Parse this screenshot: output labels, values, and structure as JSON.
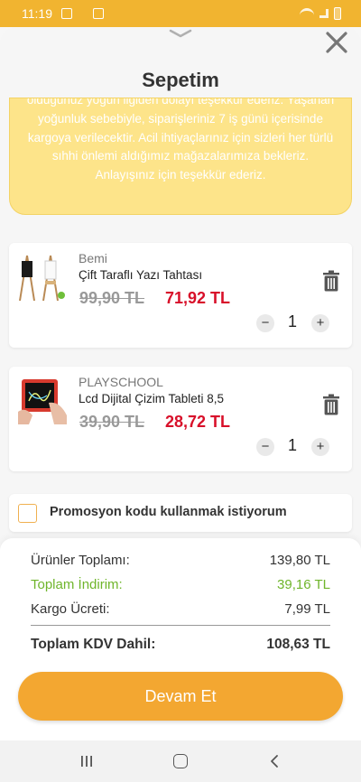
{
  "status_bar": {
    "time": "11:19"
  },
  "sheet": {
    "title": "Sepetim"
  },
  "notice": {
    "text": "olduğunuz yoğun ilgiden dolayı teşekkür ederiz. Yaşanan yoğunluk sebebiyle, siparişleriniz 7 iş günü içerisinde kargoya verilecektir. Acil ihtiyaçlarınız için sizleri her türlü sıhhi önlemi aldığımız mağazalarımıza bekleriz. Anlayışınız için teşekkür ederiz."
  },
  "cart": {
    "items": [
      {
        "brand": "Bemi",
        "name": "Çift Taraflı Yazı Tahtası",
        "old_price": "99,90 TL",
        "new_price": "71,92 TL",
        "quantity": "1",
        "minus": "−",
        "plus": "+"
      },
      {
        "brand": "PLAYSCHOOL",
        "name": "Lcd Dijital Çizim Tableti 8,5",
        "old_price": "39,90 TL",
        "new_price": "28,72 TL",
        "quantity": "1",
        "minus": "−",
        "plus": "+"
      }
    ]
  },
  "promo": {
    "label": "Promosyon kodu kullanmak istiyorum"
  },
  "summary": {
    "subtotal_label": "Ürünler Toplamı:",
    "subtotal_value": "139,80 TL",
    "discount_label": "Toplam İndirim:",
    "discount_value": "39,16 TL",
    "shipping_label": "Kargo Ücreti:",
    "shipping_value": "7,99 TL",
    "total_label": "Toplam KDV Dahil:",
    "total_value": "108,63 TL"
  },
  "cta": {
    "label": "Devam Et"
  },
  "colors": {
    "brand": "#f3a731",
    "sale_price": "#d8102a",
    "discount": "#6fb52b",
    "notice_bg": "#fde48a"
  }
}
